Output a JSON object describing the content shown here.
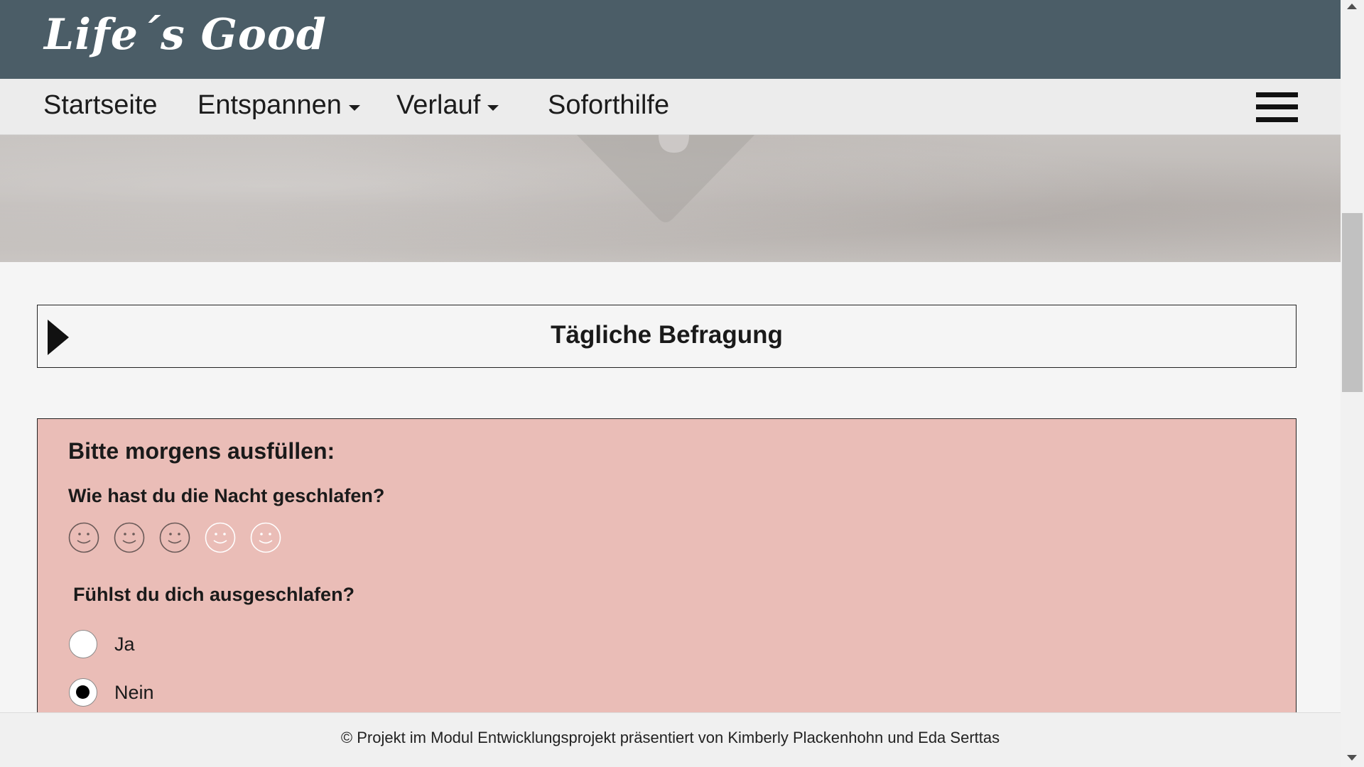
{
  "header": {
    "logo_text": "Life´s Good"
  },
  "nav": {
    "items": [
      {
        "label": "Startseite",
        "has_dropdown": false
      },
      {
        "label": "Entspannen",
        "has_dropdown": true
      },
      {
        "label": "Verlauf",
        "has_dropdown": true
      },
      {
        "label": "Soforthilfe",
        "has_dropdown": false
      }
    ],
    "menu_icon": "hamburger-icon"
  },
  "collapsible": {
    "title": "Tägliche Befragung",
    "icon": "triangle-right-icon"
  },
  "form": {
    "heading": "Bitte morgens ausfüllen:",
    "question_sleep": "Wie hast du die Nacht geschlafen?",
    "smiley_ratings": 5,
    "question_rested": "Fühlst du dich ausgeschlafen?",
    "options": [
      {
        "label": "Ja",
        "selected": false
      },
      {
        "label": "Nein",
        "selected": true
      }
    ]
  },
  "footer": {
    "text": "© Projekt im Modul Entwicklungsprojekt präsentiert von Kimberly Plackenhohn und Eda Serttas"
  },
  "colors": {
    "header_bg": "#4b5d67",
    "nav_bg": "#ececec",
    "form_bg": "#eabdb7",
    "page_bg": "#f5f5f5"
  }
}
